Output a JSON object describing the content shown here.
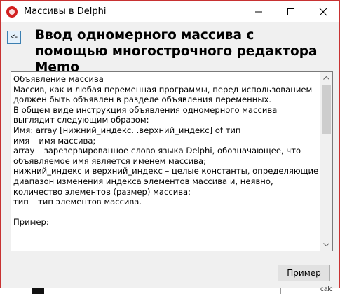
{
  "window": {
    "title": "Массивы в Delphi",
    "icon": "delphi-app-icon"
  },
  "header": {
    "back_label": "<-",
    "heading": "Ввод одномерного массива с помощью многострочного редактора Memo"
  },
  "memo": {
    "text": "Объявление массива\nМассив, как и любая переменная программы, перед использованием должен быть объявлен в разделе объявления переменных.\nВ общем виде инструкция объявления одномерного массива выглядит следующим образом:\nИмя: array [нижний_индекс. .верхний_индекс] of тип\nимя – имя массива;\narray – зарезервированное слово языка Delphi, обозначающее, что объявляемое имя является именем массива;\nнижний_индекс и верхний_индекс – целые константы, определяющие диапазон изменения индекса элементов массива и, неявно, количество элементов (размер) массива;\nтип – тип элементов массива.\n\nПример:"
  },
  "buttons": {
    "primer": "Пример"
  },
  "background": {
    "text": "calc"
  },
  "colors": {
    "accent_border": "#c83232",
    "button_focus_border": "#3c7fb1"
  }
}
